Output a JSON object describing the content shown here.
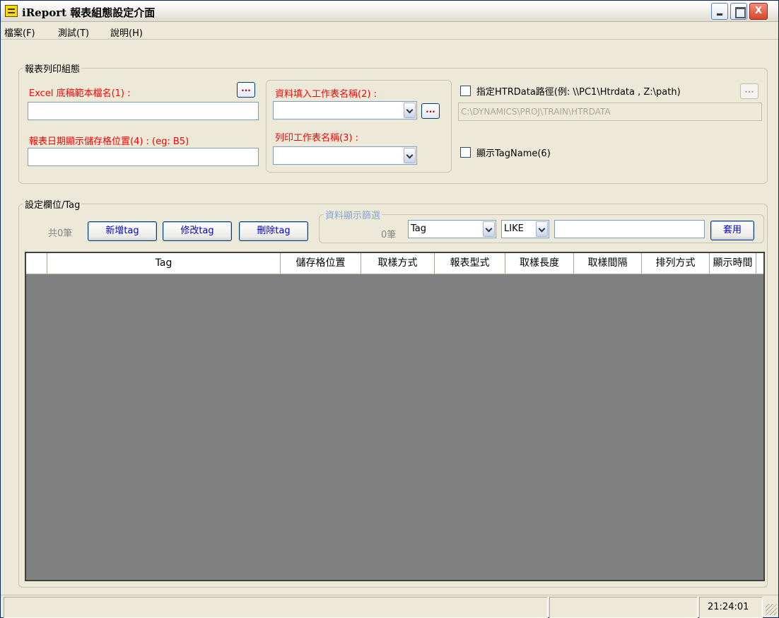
{
  "window": {
    "title": "iReport 報表組態設定介面",
    "close_glyph": "X"
  },
  "menu": [
    "檔案(F)",
    "測試(T)",
    "說明(H)"
  ],
  "report_group": {
    "legend": "報表列印組態",
    "excel_template_label": "Excel 底稿範本檔名(1) :",
    "excel_template_value": "",
    "date_cell_label": "報表日期顯示儲存格位置(4) : (eg: B5)",
    "date_cell_value": "",
    "data_sheet_label": "資料填入工作表名稱(2) :",
    "data_sheet_value": "",
    "print_sheet_label": "列印工作表名稱(3) :",
    "print_sheet_value": "",
    "browse_label": "...",
    "htrdata_label": "指定HTRData路徑(例: \\\\PC1\\Htrdata , Z:\\path)",
    "htrdata_path": "C:\\DYNAMICS\\PROJ\\TRAIN\\HTRDATA",
    "show_tagname_label": "顯示TagName(6)"
  },
  "tag_group": {
    "legend": "設定欄位/Tag",
    "count_label": "共0筆",
    "add_button": "新增tag",
    "edit_button": "修改tag",
    "delete_button": "刪除tag"
  },
  "filter_group": {
    "legend": "資料顯示篩選",
    "count_label": "0筆",
    "field_select": "Tag",
    "operator_select": "LIKE",
    "filter_value": "",
    "apply_button": "套用"
  },
  "grid": {
    "columns": [
      "Tag",
      "儲存格位置",
      "取樣方式",
      "報表型式",
      "取樣長度",
      "取樣間隔",
      "排列方式",
      "顯示時間"
    ],
    "rows": []
  },
  "status": {
    "time": "21:24:01"
  },
  "colors": {
    "required_label": "#ff0000",
    "button_text": "#0000cc",
    "grid_background": "#808080"
  }
}
